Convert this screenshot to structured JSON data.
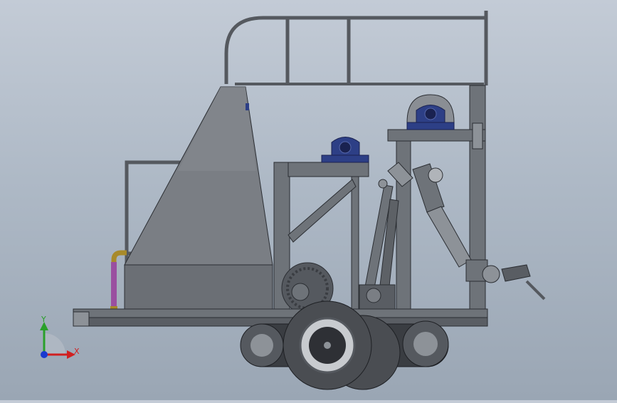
{
  "viewport": {
    "model_name": "",
    "background_top": "#c3cbd6",
    "background_bottom": "#9aa6b4"
  },
  "triad": {
    "y_label": "Y",
    "x_label": "X",
    "y_color": "#2aa02a",
    "x_color": "#d02020",
    "z_color": "#1a3ad0"
  },
  "colors": {
    "frame": "#6e7379",
    "frame_edge": "#2b2e33",
    "hopper": "#7a7e84",
    "hopper_dark": "#55595f",
    "bearing_blue": "#2d3f86",
    "hose_purple": "#9a4fa0",
    "fitting_gold": "#a88a2a",
    "tire": "#4a4d52",
    "tire_dark": "#2e3035",
    "hub": "#c8cbcf"
  }
}
